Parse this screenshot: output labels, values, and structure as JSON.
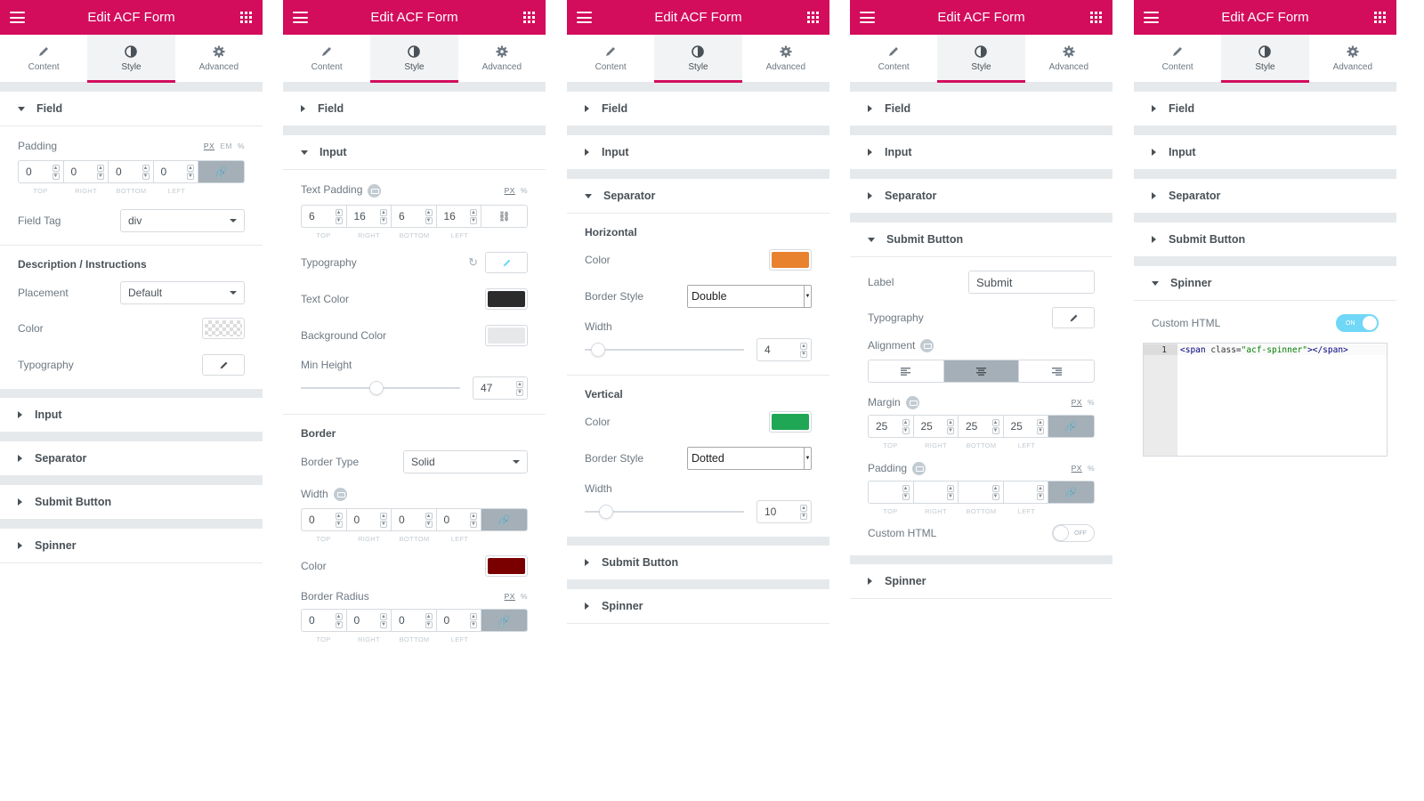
{
  "header": {
    "title": "Edit ACF Form"
  },
  "tabs": [
    "Content",
    "Style",
    "Advanced"
  ],
  "colors": {
    "accent": "#d30c5c",
    "horizontal_color": "#e8822e",
    "vertical_color": "#1fa756",
    "text_color": "#2b2b2b",
    "bg_color": "#e6e8ea",
    "border_color": "#7a0000"
  },
  "sections": {
    "field": "Field",
    "input": "Input",
    "separator": "Separator",
    "submit": "Submit Button",
    "spinner": "Spinner"
  },
  "dim_labels": [
    "TOP",
    "RIGHT",
    "BOTTOM",
    "LEFT"
  ],
  "units": {
    "px": "PX",
    "em": "EM",
    "pct": "%"
  },
  "p1": {
    "padding_label": "Padding",
    "padding": [
      "0",
      "0",
      "0",
      "0"
    ],
    "field_tag_label": "Field Tag",
    "field_tag": "div",
    "desc_heading": "Description / Instructions",
    "placement_label": "Placement",
    "placement": "Default",
    "color_label": "Color",
    "typography_label": "Typography"
  },
  "p2": {
    "text_padding_label": "Text Padding",
    "text_padding": [
      "6",
      "16",
      "6",
      "16"
    ],
    "typography_label": "Typography",
    "text_color_label": "Text Color",
    "bg_color_label": "Background Color",
    "min_height_label": "Min Height",
    "min_height": "47",
    "min_height_fraction": 0.47,
    "border_heading": "Border",
    "border_type_label": "Border Type",
    "border_type": "Solid",
    "width_label": "Width",
    "width": [
      "0",
      "0",
      "0",
      "0"
    ],
    "color_label": "Color",
    "radius_label": "Border Radius",
    "radius": [
      "0",
      "0",
      "0",
      "0"
    ]
  },
  "p3": {
    "horizontal_heading": "Horizontal",
    "color_label": "Color",
    "border_style_label": "Border Style",
    "h_border_style": "Double",
    "width_label": "Width",
    "h_width": "4",
    "h_width_fraction": 0.04,
    "vertical_heading": "Vertical",
    "v_border_style": "Dotted",
    "v_width": "10",
    "v_width_fraction": 0.1
  },
  "p4": {
    "label_label": "Label",
    "label_value": "Submit",
    "typography_label": "Typography",
    "alignment_label": "Alignment",
    "margin_label": "Margin",
    "margin": [
      "25",
      "25",
      "25",
      "25"
    ],
    "padding_label": "Padding",
    "padding": [
      "",
      "",
      "",
      ""
    ],
    "custom_html_label": "Custom HTML",
    "toggle_off": "OFF"
  },
  "p5": {
    "custom_html_label": "Custom HTML",
    "toggle_on": "ON",
    "code_line": "1",
    "code": {
      "open": "<span ",
      "attr": "class=",
      "val": "\"acf-spinner\"",
      "close": "></span>"
    }
  }
}
